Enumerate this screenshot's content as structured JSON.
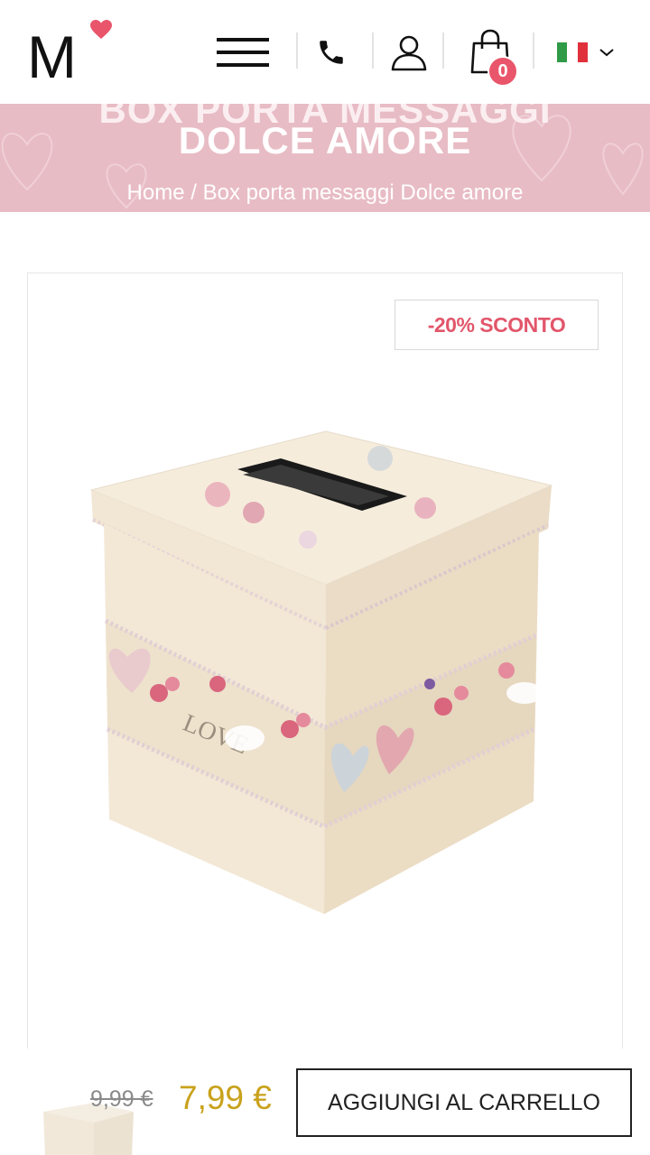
{
  "header": {
    "logo_letter": "M",
    "cart_count": "0"
  },
  "banner": {
    "title_line1": "BOX PORTA MESSAGGI",
    "title_line2": "DOLCE AMORE",
    "breadcrumb": {
      "home": "Home",
      "separator": "/",
      "current": "Box porta messaggi Dolce amore"
    }
  },
  "product": {
    "discount_label": "-20% SCONTO",
    "old_price": "9,99 €",
    "new_price": "7,99 €",
    "add_to_cart_label": "AGGIUNGI AL CARRELLO"
  },
  "colors": {
    "accent_pink": "#e9556a",
    "banner_pink": "#e8bcc5",
    "price_gold": "#c9a21c"
  },
  "icons": [
    "heart-icon",
    "hamburger-menu-icon",
    "phone-icon",
    "user-icon",
    "shopping-bag-icon",
    "italy-flag-icon",
    "chevron-down-icon"
  ]
}
